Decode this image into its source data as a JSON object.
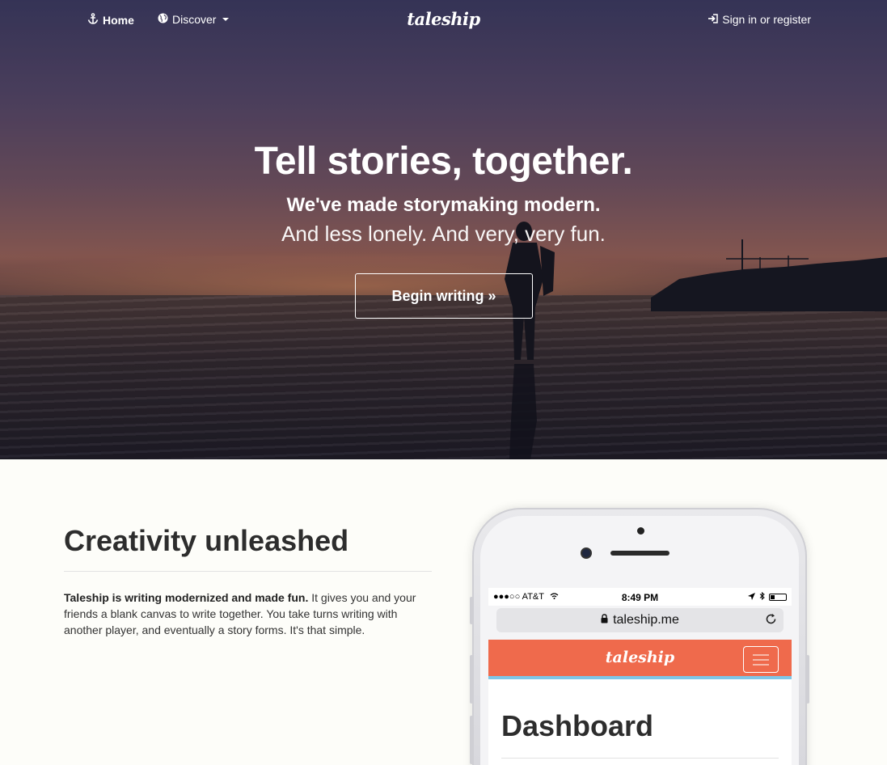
{
  "nav": {
    "home_label": "Home",
    "discover_label": "Discover",
    "brand": "taleship",
    "signin_label": "Sign in or register"
  },
  "hero": {
    "title": "Tell stories, together.",
    "subtitle": "We've made storymaking modern.",
    "tagline": "And less lonely. And very, very fun.",
    "cta_label": "Begin writing »"
  },
  "section": {
    "title": "Creativity unleashed",
    "body_bold": "Taleship is writing modernized and made fun.",
    "body_text": " It gives you and your friends a blank canvas to write together. You take turns writing with another player, and eventually a story forms. It's that simple."
  },
  "phone": {
    "carrier": "●●●○○ AT&T",
    "time": "8:49 PM",
    "url": "taleship.me",
    "app_brand": "taleship",
    "dashboard_title": "Dashboard"
  },
  "icons": {
    "home": "anchor-icon",
    "discover": "globe-icon",
    "signin": "sign-in-icon",
    "lock": "lock-icon",
    "reload": "reload-icon",
    "menu": "hamburger-icon"
  },
  "colors": {
    "app_bar": "#ef6a4c",
    "app_bar_border": "#7fc6e6",
    "page_bg": "#fdfdf9"
  }
}
